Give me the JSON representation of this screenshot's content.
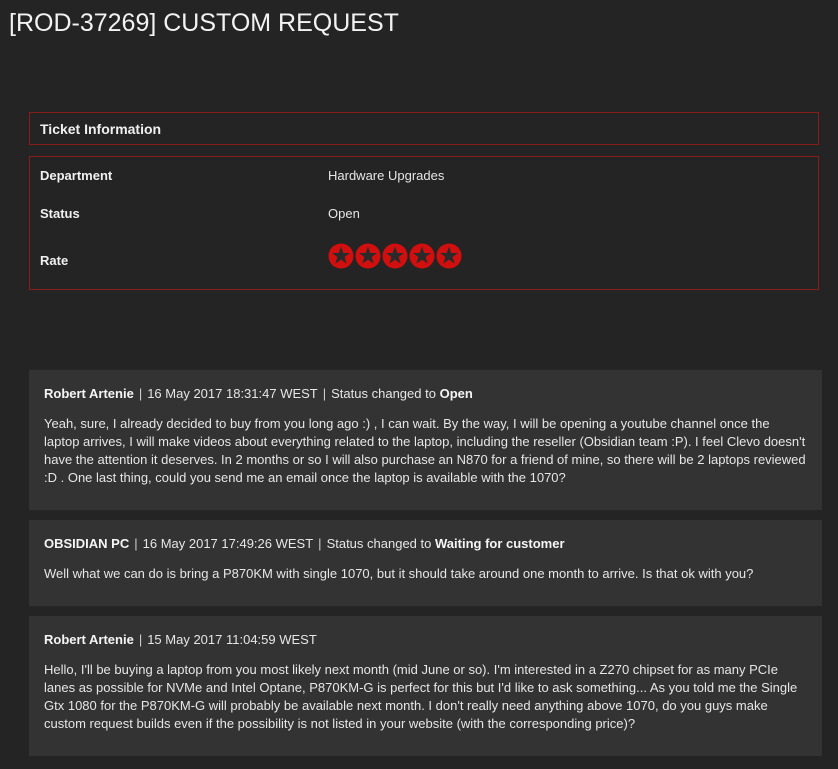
{
  "page": {
    "title": "[ROD-37269] CUSTOM REQUEST"
  },
  "ticket_info": {
    "header": "Ticket Information",
    "department_label": "Department",
    "department_value": "Hardware Upgrades",
    "status_label": "Status",
    "status_value": "Open",
    "rate_label": "Rate",
    "rating": {
      "value": 0,
      "max": 5,
      "star_color": "#d10f0f"
    }
  },
  "messages": [
    {
      "author": "Robert Artenie",
      "timestamp": "16 May 2017 18:31:47 WEST",
      "status_prefix": "Status changed to",
      "status_value": "Open",
      "body": "Yeah, sure, I already decided to buy from you long ago :) , I can wait. By the way, I will be opening a youtube channel once the laptop arrives, I will make videos about everything related to the laptop, including the reseller (Obsidian team :P). I feel Clevo doesn't have the attention it deserves. In 2 months or so I will also purchase an N870 for a friend of mine, so there will be 2 laptops reviewed :D . One last thing, could you send me an email once the laptop is available with the 1070?"
    },
    {
      "author": "OBSIDIAN PC",
      "timestamp": "16 May 2017 17:49:26 WEST",
      "status_prefix": "Status changed to",
      "status_value": "Waiting for customer",
      "body": "Well what we can do is bring a P870KM with single 1070, but it should take around one month to arrive. Is that ok with you?"
    },
    {
      "author": "Robert Artenie",
      "timestamp": "15 May 2017 11:04:59 WEST",
      "body": "Hello, I'll be buying a laptop from you most likely next month (mid June or so). I'm interested in a Z270 chipset for as many PCIe lanes as possible for NVMe and Intel Optane, P870KM-G is perfect for this but I'd like to ask something... As you told me the Single Gtx 1080 for the P870KM-G will probably be available next month. I don't really need anything above 1070, do you guys make custom request builds even if the possibility is not listed in your website (with the corresponding price)?"
    }
  ],
  "colors": {
    "background": "#242424",
    "panel": "#333333",
    "border": "#8a1c1c",
    "accent_red": "#d10f0f"
  }
}
